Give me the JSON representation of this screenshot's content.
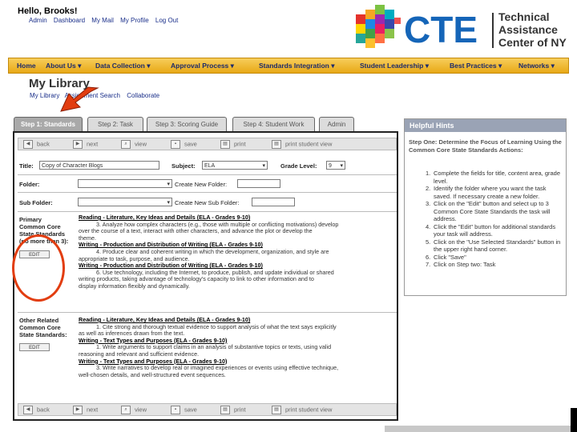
{
  "header": {
    "greeting": "Hello, Brooks!",
    "links": [
      "Admin",
      "Dashboard",
      "My Mail",
      "My Profile",
      "Log Out"
    ],
    "logo": {
      "mark": "CTE",
      "line1": "Technical",
      "line2": "Assistance",
      "line3": "Center of NY",
      "mark_color": "#1565b8",
      "text_color": "#333333"
    }
  },
  "nav": {
    "items": [
      "Home",
      "About Us ▾",
      "Data Collection ▾",
      "Approval Process ▾",
      "Standards Integration ▾",
      "Student Leadership ▾",
      "Best Practices ▾",
      "Networks ▾"
    ],
    "bar_color": "#f2bd3a"
  },
  "library": {
    "title": "My Library",
    "sublinks": [
      "My Library",
      "Assignment Search",
      "Collaborate"
    ]
  },
  "tabs": [
    "Step 1: Standards",
    "Step 2: Task",
    "Step 3: Scoring Guide",
    "Step 4: Student Work",
    "Admin"
  ],
  "toolbar": {
    "back": "back",
    "next": "next",
    "view": "view",
    "save": "save",
    "print": "print",
    "print_student_view": "print student view"
  },
  "form": {
    "title_label": "Title:",
    "title_value": "Copy of Character Blogs",
    "subject_label": "Subject:",
    "subject_value": "ELA",
    "grade_label": "Grade Level:",
    "grade_value": "9",
    "folder_label": "Folder:",
    "subfolder_label": "Sub Folder:",
    "create_folder_label": "Create New Folder:",
    "create_subfolder_label": "Create New Sub Folder:"
  },
  "primary": {
    "label_lines": [
      "Primary",
      "Common Core",
      "State Standards",
      "(no more than 3):"
    ],
    "edit_label": "EDIT",
    "standards": [
      {
        "heading": "Reading - Literature, Key Ideas and Details (ELA - Grades 9-10)",
        "lines": [
          "3. Analyze how complex characters (e.g., those with multiple or conflicting motivations) develop",
          "over the course of a text, interact with other characters, and advance the plot or develop the",
          "theme."
        ]
      },
      {
        "heading": "Writing - Production and Distribution of Writing (ELA - Grades 9-10)",
        "lines": [
          "4. Produce clear and coherent writing in which the development, organization, and style are",
          "appropriate to task, purpose, and audience."
        ]
      },
      {
        "heading": "Writing - Production and Distribution of Writing (ELA - Grades 9-10)",
        "lines": [
          "6. Use technology, including the Internet, to produce, publish, and update individual or shared",
          "writing products, taking advantage of technology's capacity to link to other information and to",
          "display information flexibly and dynamically."
        ]
      }
    ]
  },
  "other": {
    "label_lines": [
      "Other Related",
      "Common Core",
      "State Standards:"
    ],
    "edit_label": "EDIT",
    "standards": [
      {
        "heading": "Reading - Literature, Key Ideas and Details (ELA - Grades 9-10)",
        "lines": [
          "1. Cite strong and thorough textual evidence to support analysis of what the text says explicitly",
          "as well as inferences drawn from the text."
        ]
      },
      {
        "heading": "Writing - Text Types and Purposes (ELA - Grades 9-10)",
        "lines": [
          "1. Write arguments to support claims in an analysis of substantive topics or texts, using valid",
          "reasoning and relevant and sufficient evidence."
        ]
      },
      {
        "heading": "Writing - Text Types and Purposes (ELA - Grades 9-10)",
        "lines": [
          "3. Write narratives to develop real or imagined experiences or events using effective technique,",
          "well-chosen details, and well-structured event sequences."
        ]
      }
    ]
  },
  "hints": {
    "title": "Helpful Hints",
    "intro": "Step One: Determine the Focus of Learning Using the Common Core State Standards Actions:",
    "items": [
      "Complete the fields for title, content area, grade level.",
      "Identify the folder where you want the task saved. If necessary create a new folder.",
      "Click on the \"Edit\" button and select up to 3 Common Core State Standards the task will address.",
      "Click the \"Edit\" button for additional standards your task will address.",
      "Click on the \"Use Selected Standards\" button in the upper right hand corner.",
      "Click \"Save\"",
      "Click on Step two: Task"
    ]
  },
  "overlay": {
    "circle_color": "#e23d10",
    "arrow_color": "#e23d10"
  }
}
